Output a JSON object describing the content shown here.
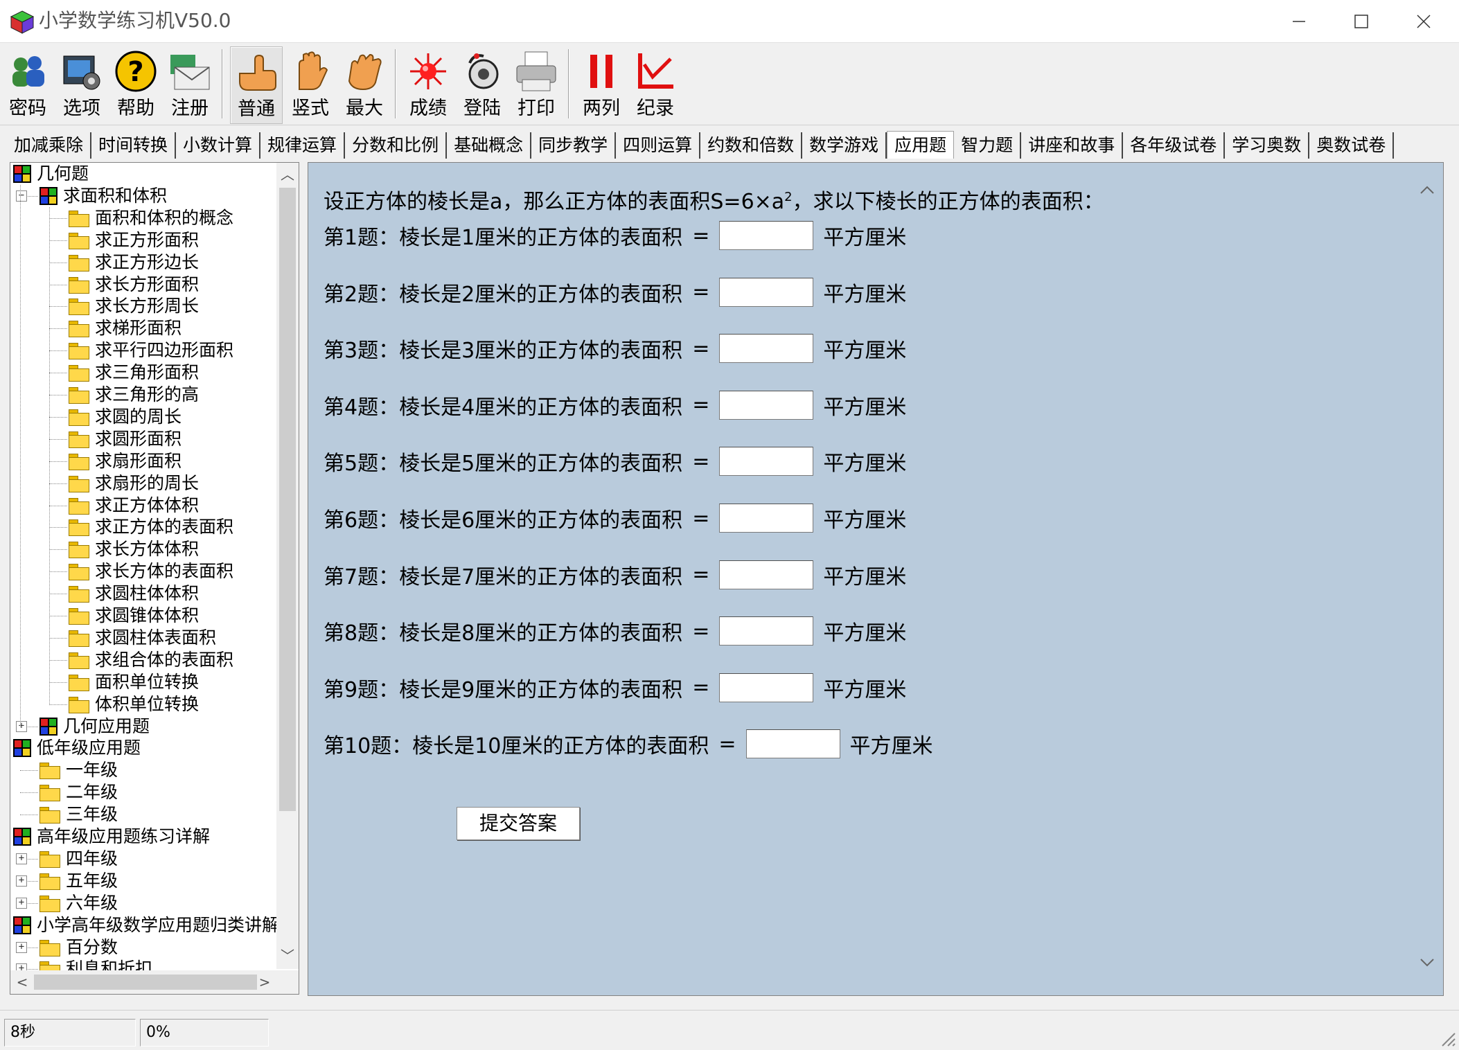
{
  "window": {
    "title": "小学数学练习机V50.0"
  },
  "toolbar": {
    "buttons": [
      {
        "label": "密码",
        "icon": "users-key-icon"
      },
      {
        "label": "选项",
        "icon": "options-icon"
      },
      {
        "label": "帮助",
        "icon": "help-icon"
      },
      {
        "label": "注册",
        "icon": "register-envelope-icon"
      },
      {
        "label": "普通",
        "icon": "pointing-hand-icon"
      },
      {
        "label": "竖式",
        "icon": "raised-hand-icon"
      },
      {
        "label": "最大",
        "icon": "open-hand-icon"
      },
      {
        "label": "成绩",
        "icon": "score-burst-icon"
      },
      {
        "label": "登陆",
        "icon": "login-icon"
      },
      {
        "label": "打印",
        "icon": "printer-icon"
      },
      {
        "label": "两列",
        "icon": "two-columns-icon"
      },
      {
        "label": "纪录",
        "icon": "chart-record-icon"
      }
    ]
  },
  "tabs": [
    "加减乘除",
    "时间转换",
    "小数计算",
    "规律运算",
    "分数和比例",
    "基础概念",
    "同步教学",
    "四则运算",
    "约数和倍数",
    "数学游戏",
    "应用题",
    "智力题",
    "讲座和故事",
    "各年级试卷",
    "学习奥数",
    "奥数试卷"
  ],
  "active_tab": "应用题",
  "tree": {
    "root": "几何题",
    "group1": "求面积和体积",
    "group1_items": [
      "面积和体积的概念",
      "求正方形面积",
      "求正方形边长",
      "求长方形面积",
      "求长方形周长",
      "求梯形面积",
      "求平行四边形面积",
      "求三角形面积",
      "求三角形的高",
      "求圆的周长",
      "求圆形面积",
      "求扇形面积",
      "求扇形的周长",
      "求正方体体积",
      "求正方体的表面积",
      "求长方体体积",
      "求长方体的表面积",
      "求圆柱体体积",
      "求圆锥体体积",
      "求圆柱体表面积",
      "求组合体的表面积",
      "面积单位转换",
      "体积单位转换"
    ],
    "group2": "几何应用题",
    "low_grade": "低年级应用题",
    "low_items": [
      "一年级",
      "二年级",
      "三年级"
    ],
    "high_grade": "高年级应用题练习详解",
    "high_items": [
      "四年级",
      "五年级",
      "六年级"
    ],
    "summary": "小学高年级数学应用题归类讲解",
    "summary_items": [
      "百分数",
      "利息和折扣"
    ]
  },
  "main": {
    "intro_prefix": "设正方体的棱长是a，那么正方体的表面积S=6×a",
    "intro_sup": "2",
    "intro_suffix": "，求以下棱长的正方体的表面积：",
    "questions": [
      {
        "text": "第1题：棱长是1厘米的正方体的表面积",
        "eq": "=",
        "value": "",
        "unit": "平方厘米"
      },
      {
        "text": "第2题：棱长是2厘米的正方体的表面积",
        "eq": "=",
        "value": "",
        "unit": "平方厘米"
      },
      {
        "text": "第3题：棱长是3厘米的正方体的表面积",
        "eq": "=",
        "value": "",
        "unit": "平方厘米"
      },
      {
        "text": "第4题：棱长是4厘米的正方体的表面积",
        "eq": "=",
        "value": "",
        "unit": "平方厘米"
      },
      {
        "text": "第5题：棱长是5厘米的正方体的表面积",
        "eq": "=",
        "value": "",
        "unit": "平方厘米"
      },
      {
        "text": "第6题：棱长是6厘米的正方体的表面积",
        "eq": "=",
        "value": "",
        "unit": "平方厘米"
      },
      {
        "text": "第7题：棱长是7厘米的正方体的表面积",
        "eq": "=",
        "value": "",
        "unit": "平方厘米"
      },
      {
        "text": "第8题：棱长是8厘米的正方体的表面积",
        "eq": "=",
        "value": "",
        "unit": "平方厘米"
      },
      {
        "text": "第9题：棱长是9厘米的正方体的表面积",
        "eq": "=",
        "value": "",
        "unit": "平方厘米"
      },
      {
        "text": "第10题：棱长是10厘米的正方体的表面积",
        "eq": "=",
        "value": "",
        "unit": "平方厘米"
      }
    ],
    "submit_label": "提交答案"
  },
  "status": {
    "time": "8秒",
    "progress": "0%"
  },
  "colors": {
    "main_bg": "#b9cbdc"
  }
}
